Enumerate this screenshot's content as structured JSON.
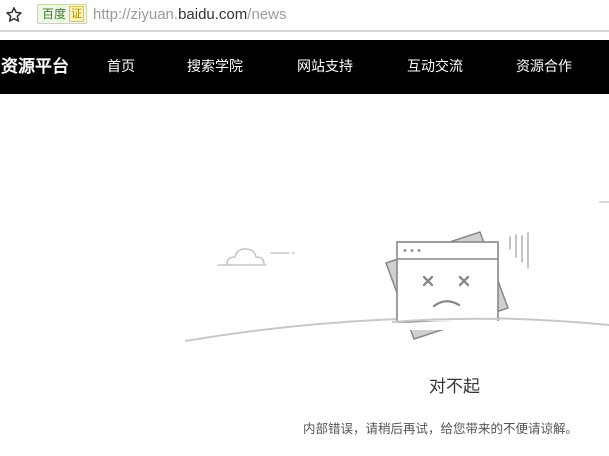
{
  "address_bar": {
    "badge_label": "百度",
    "cert_label": "证",
    "url_prefix": "http://ziyuan.",
    "url_domain": "baidu.com",
    "url_path": "/news"
  },
  "nav": {
    "brand": "资源平台",
    "items": [
      "首页",
      "搜索学院",
      "网站支持",
      "互动交流",
      "资源合作"
    ]
  },
  "error": {
    "title": "对不起",
    "message": "内部错误，请稍后再试，给您带来的不便请谅解。"
  },
  "colors": {
    "nav_bg": "#000000",
    "nav_text": "#ffffff",
    "badge_green": "#2e8b22",
    "illustration_stroke": "#999999"
  }
}
